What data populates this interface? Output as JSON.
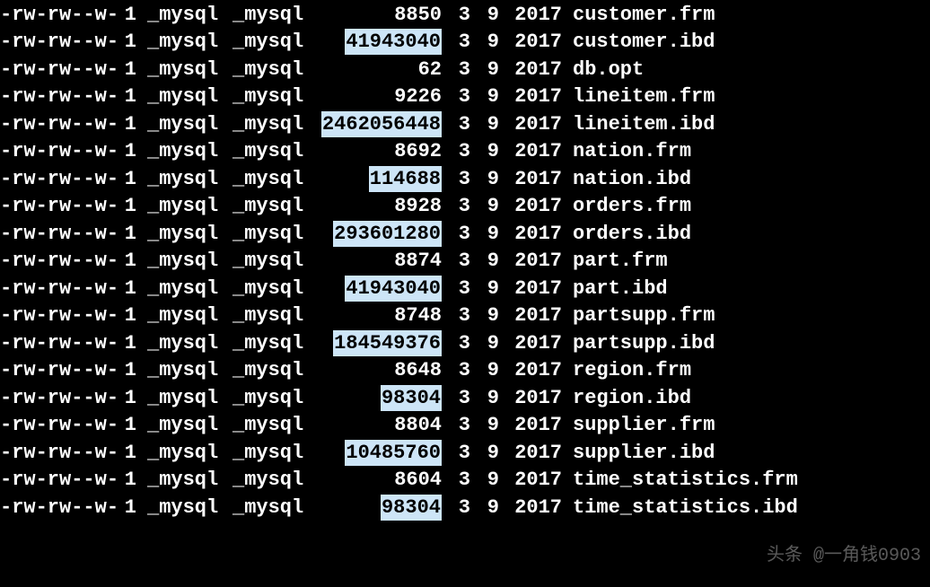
{
  "watermark": "头条 @一角钱0903",
  "rows": [
    {
      "perms": "-rw-rw--w-",
      "links": "1",
      "owner": "_mysql",
      "group": "_mysql",
      "size": "8850",
      "highlight": false,
      "month": "3",
      "day": "9",
      "year": "2017",
      "filename": "customer.frm"
    },
    {
      "perms": "-rw-rw--w-",
      "links": "1",
      "owner": "_mysql",
      "group": "_mysql",
      "size": "41943040",
      "highlight": true,
      "month": "3",
      "day": "9",
      "year": "2017",
      "filename": "customer.ibd"
    },
    {
      "perms": "-rw-rw--w-",
      "links": "1",
      "owner": "_mysql",
      "group": "_mysql",
      "size": "62",
      "highlight": false,
      "month": "3",
      "day": "9",
      "year": "2017",
      "filename": "db.opt"
    },
    {
      "perms": "-rw-rw--w-",
      "links": "1",
      "owner": "_mysql",
      "group": "_mysql",
      "size": "9226",
      "highlight": false,
      "month": "3",
      "day": "9",
      "year": "2017",
      "filename": "lineitem.frm"
    },
    {
      "perms": "-rw-rw--w-",
      "links": "1",
      "owner": "_mysql",
      "group": "_mysql",
      "size": "2462056448",
      "highlight": true,
      "month": "3",
      "day": "9",
      "year": "2017",
      "filename": "lineitem.ibd"
    },
    {
      "perms": "-rw-rw--w-",
      "links": "1",
      "owner": "_mysql",
      "group": "_mysql",
      "size": "8692",
      "highlight": false,
      "month": "3",
      "day": "9",
      "year": "2017",
      "filename": "nation.frm"
    },
    {
      "perms": "-rw-rw--w-",
      "links": "1",
      "owner": "_mysql",
      "group": "_mysql",
      "size": "114688",
      "highlight": true,
      "month": "3",
      "day": "9",
      "year": "2017",
      "filename": "nation.ibd"
    },
    {
      "perms": "-rw-rw--w-",
      "links": "1",
      "owner": "_mysql",
      "group": "_mysql",
      "size": "8928",
      "highlight": false,
      "month": "3",
      "day": "9",
      "year": "2017",
      "filename": "orders.frm"
    },
    {
      "perms": "-rw-rw--w-",
      "links": "1",
      "owner": "_mysql",
      "group": "_mysql",
      "size": "293601280",
      "highlight": true,
      "month": "3",
      "day": "9",
      "year": "2017",
      "filename": "orders.ibd"
    },
    {
      "perms": "-rw-rw--w-",
      "links": "1",
      "owner": "_mysql",
      "group": "_mysql",
      "size": "8874",
      "highlight": false,
      "month": "3",
      "day": "9",
      "year": "2017",
      "filename": "part.frm"
    },
    {
      "perms": "-rw-rw--w-",
      "links": "1",
      "owner": "_mysql",
      "group": "_mysql",
      "size": "41943040",
      "highlight": true,
      "month": "3",
      "day": "9",
      "year": "2017",
      "filename": "part.ibd"
    },
    {
      "perms": "-rw-rw--w-",
      "links": "1",
      "owner": "_mysql",
      "group": "_mysql",
      "size": "8748",
      "highlight": false,
      "month": "3",
      "day": "9",
      "year": "2017",
      "filename": "partsupp.frm"
    },
    {
      "perms": "-rw-rw--w-",
      "links": "1",
      "owner": "_mysql",
      "group": "_mysql",
      "size": "184549376",
      "highlight": true,
      "month": "3",
      "day": "9",
      "year": "2017",
      "filename": "partsupp.ibd"
    },
    {
      "perms": "-rw-rw--w-",
      "links": "1",
      "owner": "_mysql",
      "group": "_mysql",
      "size": "8648",
      "highlight": false,
      "month": "3",
      "day": "9",
      "year": "2017",
      "filename": "region.frm"
    },
    {
      "perms": "-rw-rw--w-",
      "links": "1",
      "owner": "_mysql",
      "group": "_mysql",
      "size": "98304",
      "highlight": true,
      "month": "3",
      "day": "9",
      "year": "2017",
      "filename": "region.ibd"
    },
    {
      "perms": "-rw-rw--w-",
      "links": "1",
      "owner": "_mysql",
      "group": "_mysql",
      "size": "8804",
      "highlight": false,
      "month": "3",
      "day": "9",
      "year": "2017",
      "filename": "supplier.frm"
    },
    {
      "perms": "-rw-rw--w-",
      "links": "1",
      "owner": "_mysql",
      "group": "_mysql",
      "size": "10485760",
      "highlight": true,
      "month": "3",
      "day": "9",
      "year": "2017",
      "filename": "supplier.ibd"
    },
    {
      "perms": "-rw-rw--w-",
      "links": "1",
      "owner": "_mysql",
      "group": "_mysql",
      "size": "8604",
      "highlight": false,
      "month": "3",
      "day": "9",
      "year": "2017",
      "filename": "time_statistics.frm"
    },
    {
      "perms": "-rw-rw--w-",
      "links": "1",
      "owner": "_mysql",
      "group": "_mysql",
      "size": "98304",
      "highlight": true,
      "month": "3",
      "day": "9",
      "year": "2017",
      "filename": "time_statistics.ibd"
    }
  ]
}
